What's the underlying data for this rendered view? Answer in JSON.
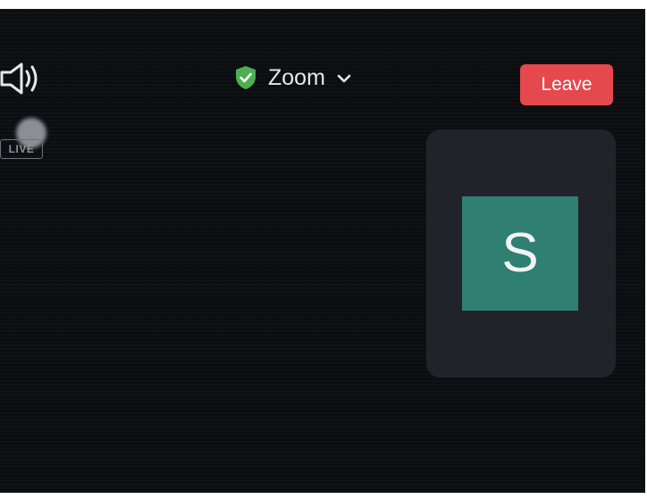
{
  "header": {
    "title": "Zoom",
    "secure_icon": "shield-check-icon",
    "dropdown_icon": "chevron-down-icon",
    "speaker_icon": "speaker-icon"
  },
  "live_indicator": {
    "label": "LIVE"
  },
  "leave_button": {
    "label": "Leave",
    "color": "#e5484d"
  },
  "self_view": {
    "initial": "S",
    "avatar_color": "#2f7f72"
  },
  "colors": {
    "background": "#0b0d10",
    "tile": "#20242a",
    "secure": "#4caf50"
  }
}
